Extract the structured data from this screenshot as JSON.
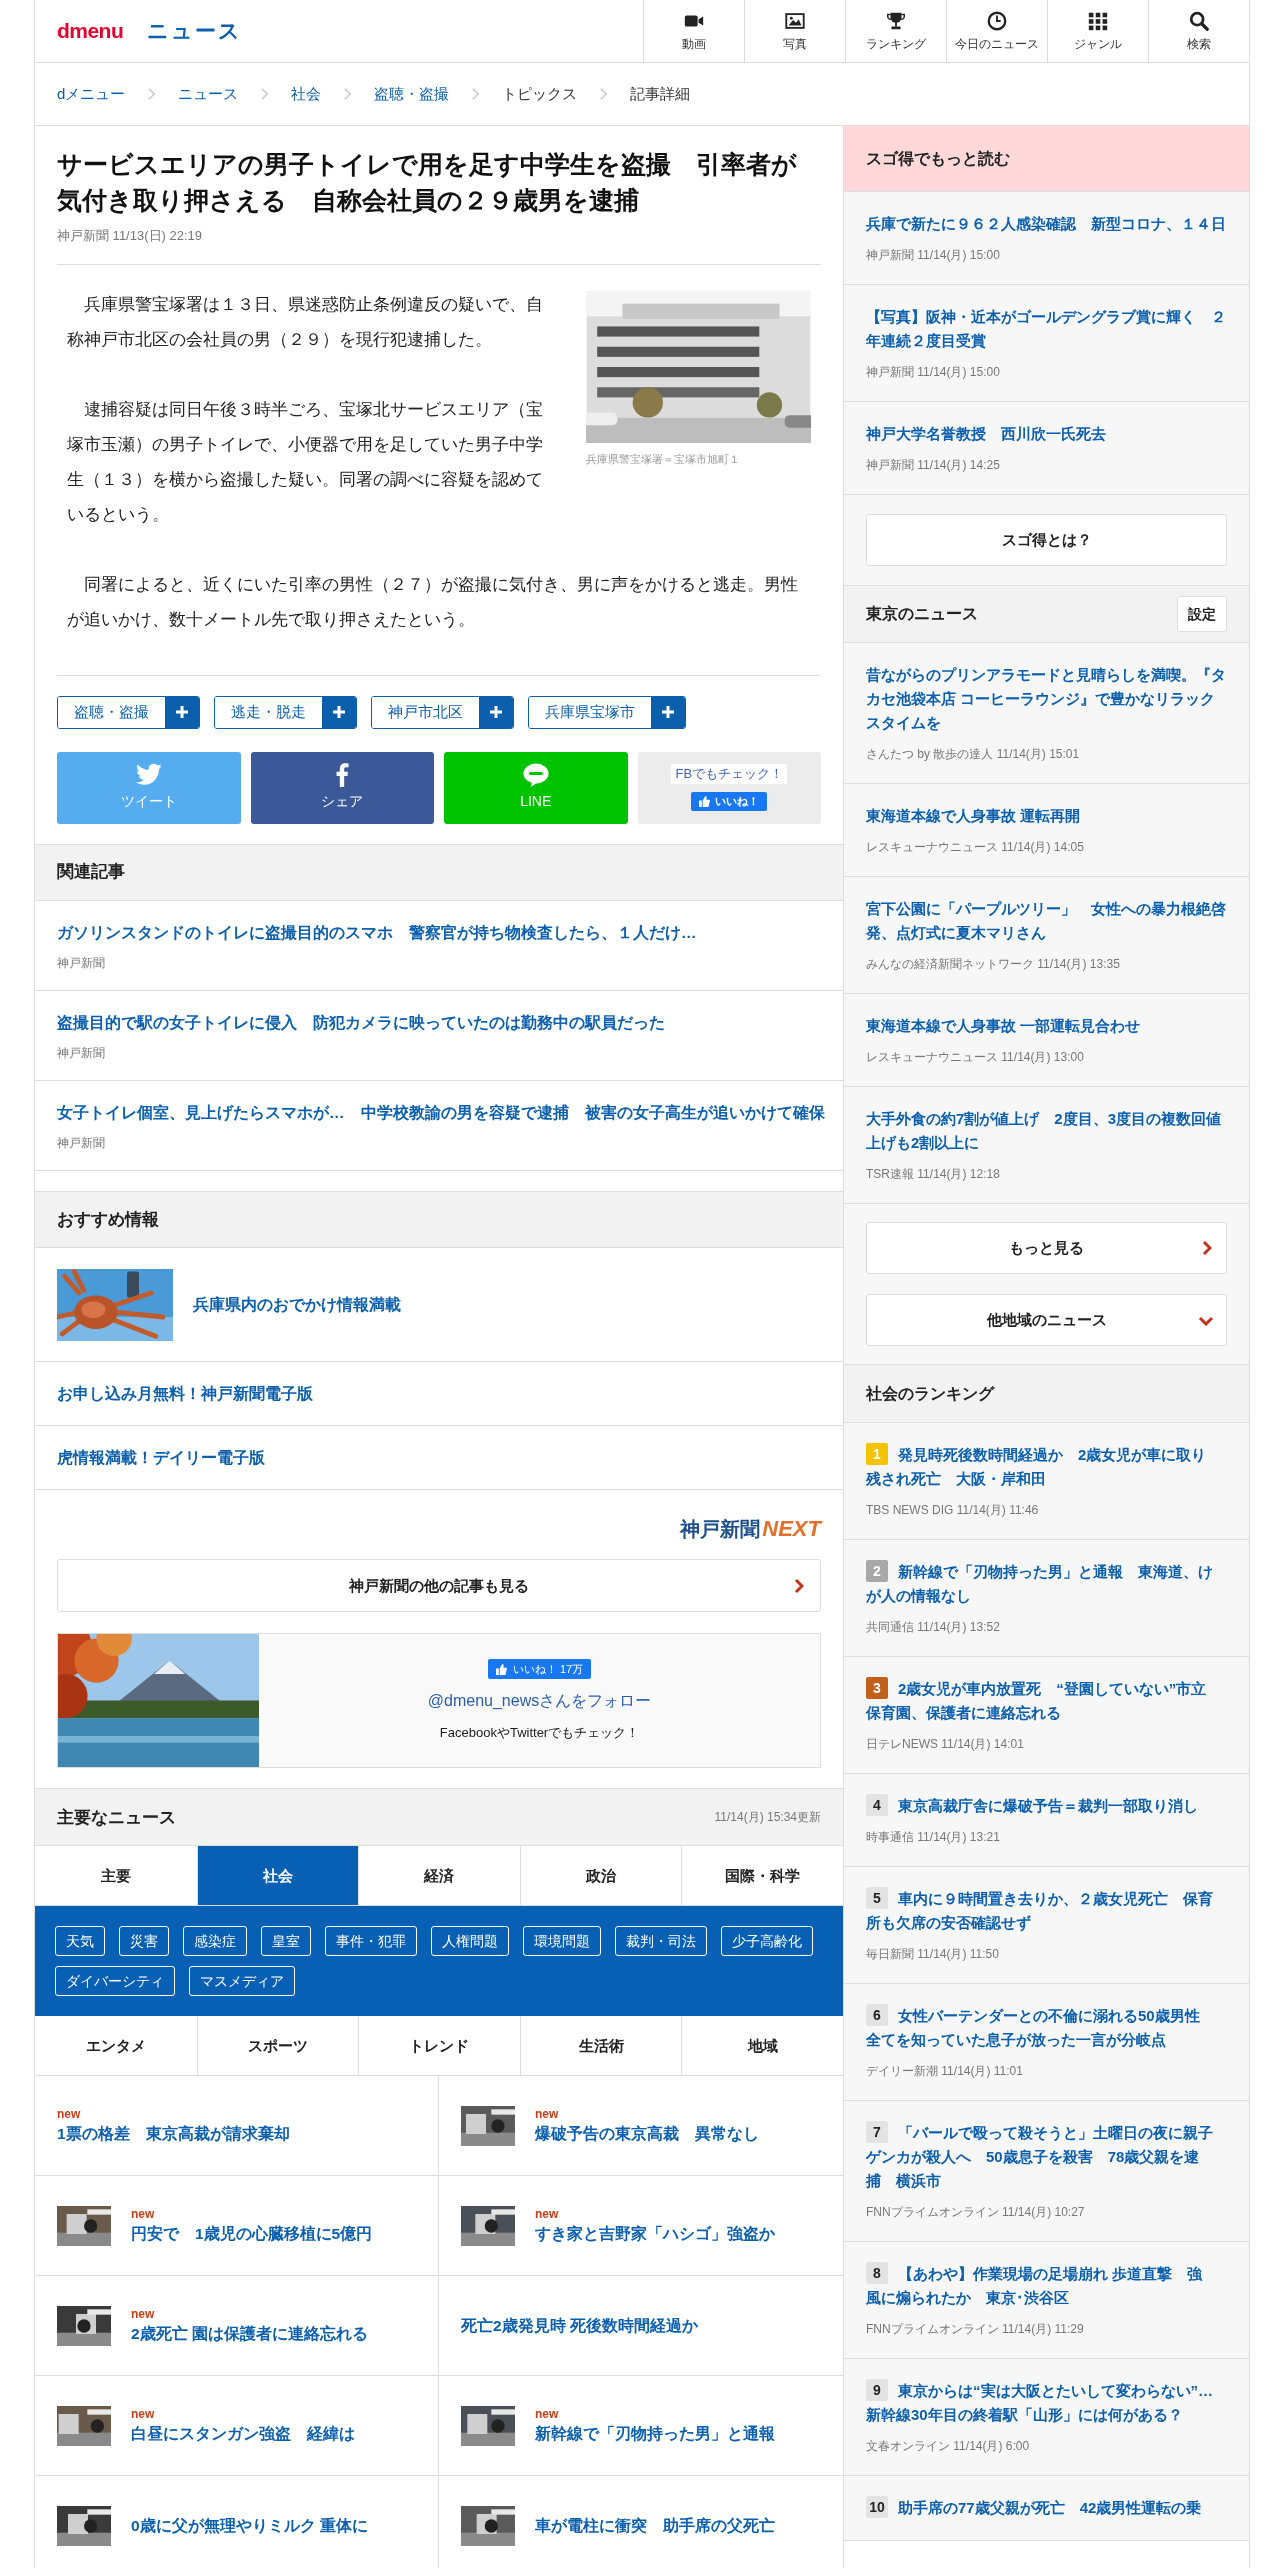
{
  "header": {
    "logo": "dmenu",
    "section": "ニュース",
    "nav": [
      {
        "label": "動画"
      },
      {
        "label": "写真"
      },
      {
        "label": "ランキング"
      },
      {
        "label": "今日のニュース"
      },
      {
        "label": "ジャンル"
      },
      {
        "label": "検索"
      }
    ]
  },
  "breadcrumb": [
    {
      "label": "dメニュー",
      "link": true
    },
    {
      "label": "ニュース",
      "link": true
    },
    {
      "label": "社会",
      "link": true
    },
    {
      "label": "盗聴・盗撮",
      "link": true
    },
    {
      "label": "トピックス",
      "link": false
    },
    {
      "label": "記事詳細",
      "link": false
    }
  ],
  "article": {
    "title": "サービスエリアの男子トイレで用を足す中学生を盗撮　引率者が気付き取り押さえる　自称会社員の２９歳男を逮捕",
    "meta": "神戸新聞 11/13(日) 22:19",
    "image": {
      "kind": "picture",
      "caption": "兵庫県警宝塚署＝宝塚市旭町１"
    },
    "paragraphs": [
      "　兵庫県警宝塚署は１３日、県迷惑防止条例違反の疑いで、自称神戸市北区の会社員の男（２９）を現行犯逮捕した。",
      "　逮捕容疑は同日午後３時半ごろ、宝塚北サービスエリア（宝塚市玉瀬）の男子トイレで、小便器で用を足していた男子中学生（１３）を横から盗撮した疑い。同署の調べに容疑を認めているという。",
      "　同署によると、近くにいた引率の男性（２７）が盗撮に気付き、男に声をかけると逃走。男性が追いかけ、数十メートル先で取り押さえたという。"
    ],
    "tags": [
      "盗聴・盗撮",
      "逃走・脱走",
      "神戸市北区",
      "兵庫県宝塚市"
    ],
    "share": [
      {
        "kind": "twitter",
        "label": "ツイート"
      },
      {
        "kind": "facebook",
        "label": "シェア"
      },
      {
        "kind": "line",
        "label": "LINE"
      },
      {
        "kind": "fb_box",
        "label": "FBでもチェック！",
        "button": "いいね！"
      }
    ]
  },
  "related": {
    "title": "関連記事",
    "items": [
      {
        "title": "ガソリンスタンドのトイレに盗撮目的のスマホ　警察官が持ち物検査したら、１人だけ…",
        "source": "神戸新聞"
      },
      {
        "title": "盗撮目的で駅の女子トイレに侵入　防犯カメラに映っていたのは勤務中の駅員だった",
        "source": "神戸新聞"
      },
      {
        "title": "女子トイレ個室、見上げたらスマホが…　中学校教諭の男を容疑で逮捕　被害の女子高生が追いかけて確保",
        "source": "神戸新聞"
      }
    ]
  },
  "recommended": {
    "title": "おすすめ情報",
    "items": [
      {
        "title": "兵庫県内のおでかけ情報満載",
        "thumbnail": true
      },
      {
        "title": "お申し込み月無料！神戸新聞電子版",
        "thumbnail": false
      },
      {
        "title": "虎情報満載！デイリー電子版",
        "thumbnail": false
      }
    ]
  },
  "partner": {
    "logo_main": "神戸新聞",
    "logo_accent": "NEXT",
    "more_button": "神戸新聞の他の記事も見る"
  },
  "follow": {
    "like": "いいね！ 17万",
    "handle": "@dmenu_newsさんをフォロー",
    "note": "FacebookやTwitterでもチェック！"
  },
  "main_news": {
    "title": "主要なニュース",
    "updated": "11/14(月) 15:34更新",
    "tabs": [
      {
        "label": "主要",
        "selected": false
      },
      {
        "label": "社会",
        "selected": true
      },
      {
        "label": "経済",
        "selected": false
      },
      {
        "label": "政治",
        "selected": false
      },
      {
        "label": "国際・科学",
        "selected": false
      },
      {
        "label": "エンタメ",
        "selected": false
      },
      {
        "label": "スポーツ",
        "selected": false
      },
      {
        "label": "トレンド",
        "selected": false
      },
      {
        "label": "生活術",
        "selected": false
      },
      {
        "label": "地域",
        "selected": false
      }
    ],
    "topics": [
      "天気",
      "災害",
      "感染症",
      "皇室",
      "事件・犯罪",
      "人権問題",
      "環境問題",
      "裁判・司法",
      "少子高齢化",
      "ダイバーシティ",
      "マスメディア"
    ],
    "items": [
      {
        "title": "1票の格差　東京高裁が請求棄却",
        "badge": "new",
        "thumbnail": false
      },
      {
        "title": "爆破予告の東京高裁　異常なし",
        "badge": "new",
        "thumbnail": true
      },
      {
        "title": "円安で　1歳児の心臓移植に5億円",
        "badge": "new",
        "thumbnail": true
      },
      {
        "title": "すき家と吉野家「ハシゴ」強盗か",
        "badge": "new",
        "thumbnail": true
      },
      {
        "title": "2歳死亡 園は保護者に連絡忘れる",
        "badge": "new",
        "thumbnail": true
      },
      {
        "title": "死亡2歳発見時 死後数時間経過か",
        "thumbnail": false
      },
      {
        "title": "白昼にスタンガン強盗　経緯は",
        "badge": "new",
        "thumbnail": true
      },
      {
        "title": "新幹線で「刃物持った男」と通報",
        "badge": "new",
        "thumbnail": true
      },
      {
        "title": "0歳に父が無理やりミルク 重体に",
        "thumbnail": true
      },
      {
        "title": "車が電柱に衝突　助手席の父死亡",
        "thumbnail": true
      }
    ]
  },
  "sidebar": {
    "sugotoku": {
      "title": "スゴ得でもっと読む",
      "items": [
        {
          "title": "兵庫で新たに９６２人感染確認　新型コロナ、１４日",
          "meta": "神戸新聞 11/14(月) 15:00"
        },
        {
          "title": "【写真】阪神・近本がゴールデングラブ賞に輝く　２年連続２度目受賞",
          "meta": "神戸新聞 11/14(月) 15:00"
        },
        {
          "title": "神戸大学名誉教授　西川欣一氏死去",
          "meta": "神戸新聞 11/14(月) 14:25"
        }
      ],
      "button": "スゴ得とは？"
    },
    "tokyo": {
      "title": "東京のニュース",
      "settings": "設定",
      "items": [
        {
          "title": "昔ながらのプリンアラモードと見晴らしを満喫。『タカセ池袋本店 コーヒーラウンジ』で豊かなリラックスタイムを",
          "meta": "さんたつ by 散歩の達人 11/14(月) 15:01"
        },
        {
          "title": "東海道本線で人身事故 運転再開",
          "meta": "レスキューナウニュース 11/14(月) 14:05"
        },
        {
          "title": "宮下公園に「パープルツリー」　女性への暴力根絶啓発、点灯式に夏木マリさん",
          "meta": "みんなの経済新聞ネットワーク 11/14(月) 13:35"
        },
        {
          "title": "東海道本線で人身事故 一部運転見合わせ",
          "meta": "レスキューナウニュース 11/14(月) 13:00"
        },
        {
          "title": "大手外食の約7割が値上げ　2度目、3度目の複数回値上げも2割以上に",
          "meta": "TSR速報 11/14(月) 12:18"
        }
      ],
      "more": "もっと見る",
      "other": "他地域のニュース"
    },
    "ranking": {
      "title": "社会のランキング",
      "items": [
        {
          "rank": "1",
          "color": "#f5c300",
          "title": "発見時死後数時間経過か　2歳女児が車に取り残され死亡　大阪・岸和田",
          "meta": "TBS NEWS DIG 11/14(月) 11:46"
        },
        {
          "rank": "2",
          "color": "#a8a8a8",
          "title": "新幹線で「刃物持った男」と通報　東海道、けが人の情報なし",
          "meta": "共同通信 11/14(月) 13:52"
        },
        {
          "rank": "3",
          "color": "#c0601c",
          "title": "2歳女児が車内放置死　“登園していない”市立保育園、保護者に連絡忘れる",
          "meta": "日テレNEWS 11/14(月) 14:01"
        },
        {
          "rank": "4",
          "color": "#e3e3e3",
          "title": "東京高裁庁舎に爆破予告＝裁判一部取り消し",
          "meta": "時事通信 11/14(月) 13:21"
        },
        {
          "rank": "5",
          "color": "#e3e3e3",
          "title": "車内に９時間置き去りか、２歳女児死亡　保育所も欠席の安否確認せず",
          "meta": "毎日新聞 11/14(月) 11:50"
        },
        {
          "rank": "6",
          "color": "#e3e3e3",
          "title": "女性バーテンダーとの不倫に溺れる50歳男性全てを知っていた息子が放った一言が分岐点",
          "meta": "デイリー新潮 11/14(月) 11:01"
        },
        {
          "rank": "7",
          "color": "#e3e3e3",
          "title": "「バールで殴って殺そうと」土曜日の夜に親子ゲンカが殺人へ　50歳息子を殺害　78歳父親を逮捕　横浜市",
          "meta": "FNNプライムオンライン 11/14(月) 10:27"
        },
        {
          "rank": "8",
          "color": "#e3e3e3",
          "title": "【あわや】作業現場の足場崩れ 歩道直撃　強風に煽られたか　東京･渋谷区",
          "meta": "FNNプライムオンライン 11/14(月) 11:29"
        },
        {
          "rank": "9",
          "color": "#e3e3e3",
          "title": "東京からは“実は大阪とたいして変わらない”…新幹線30年目の終着駅「山形」には何がある？",
          "meta": "文春オンライン 11/14(月) 6:00"
        },
        {
          "rank": "10",
          "color": "#e3e3e3",
          "title": "助手席の77歳父親が死亡　42歳男性運転の乗"
        }
      ]
    }
  }
}
